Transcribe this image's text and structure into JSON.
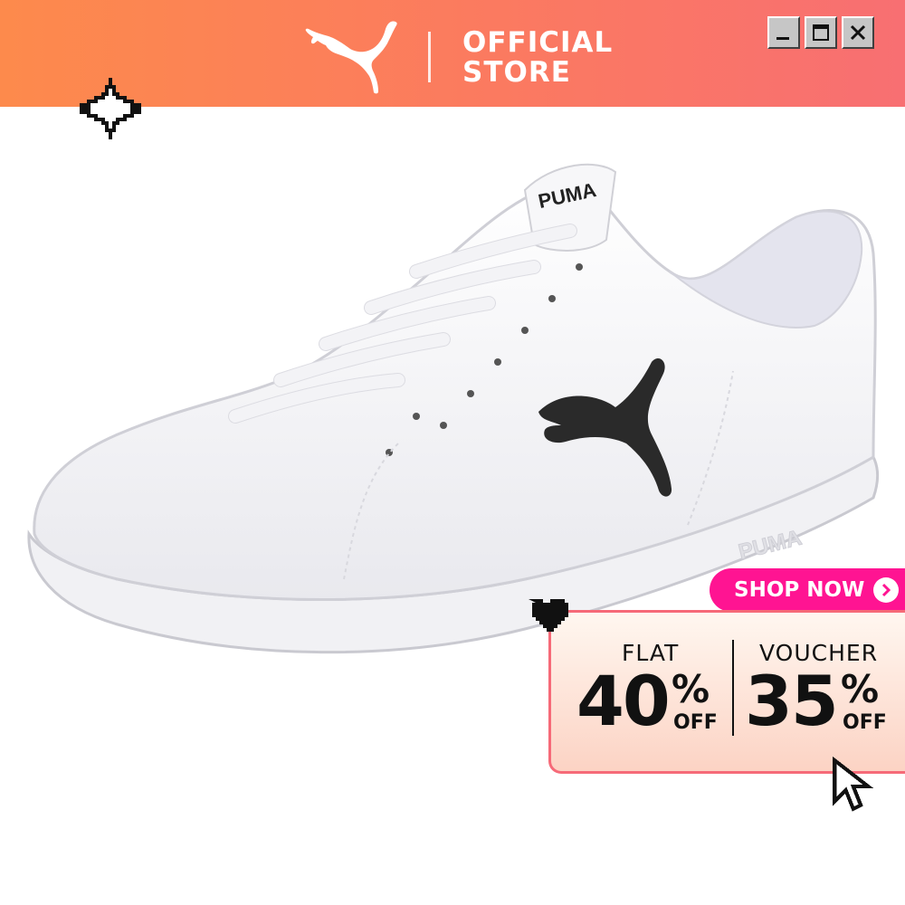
{
  "header": {
    "store_line1": "OFFICIAL",
    "store_line2": "STORE",
    "logo_icon": "puma-cat-icon",
    "window_controls": [
      "minimize-icon",
      "maximize-icon",
      "close-icon"
    ],
    "gradient": [
      "#fd8a4c",
      "#f86f72"
    ]
  },
  "promo": {
    "shop_now": "SHOP NOW",
    "shop_now_color": "#ff1492",
    "flat_label": "FLAT",
    "flat_value": "40",
    "flat_pct": "%",
    "flat_off": "OFF",
    "voucher_label": "VOUCHER",
    "voucher_value": "35",
    "voucher_pct": "%",
    "voucher_off": "OFF"
  },
  "product": {
    "tongue_logo_text": "PUMA",
    "sole_logo_text": "PUMA"
  },
  "decorations": [
    "sparkle-icon",
    "pixel-heart-icon",
    "pixel-cursor-icon"
  ]
}
